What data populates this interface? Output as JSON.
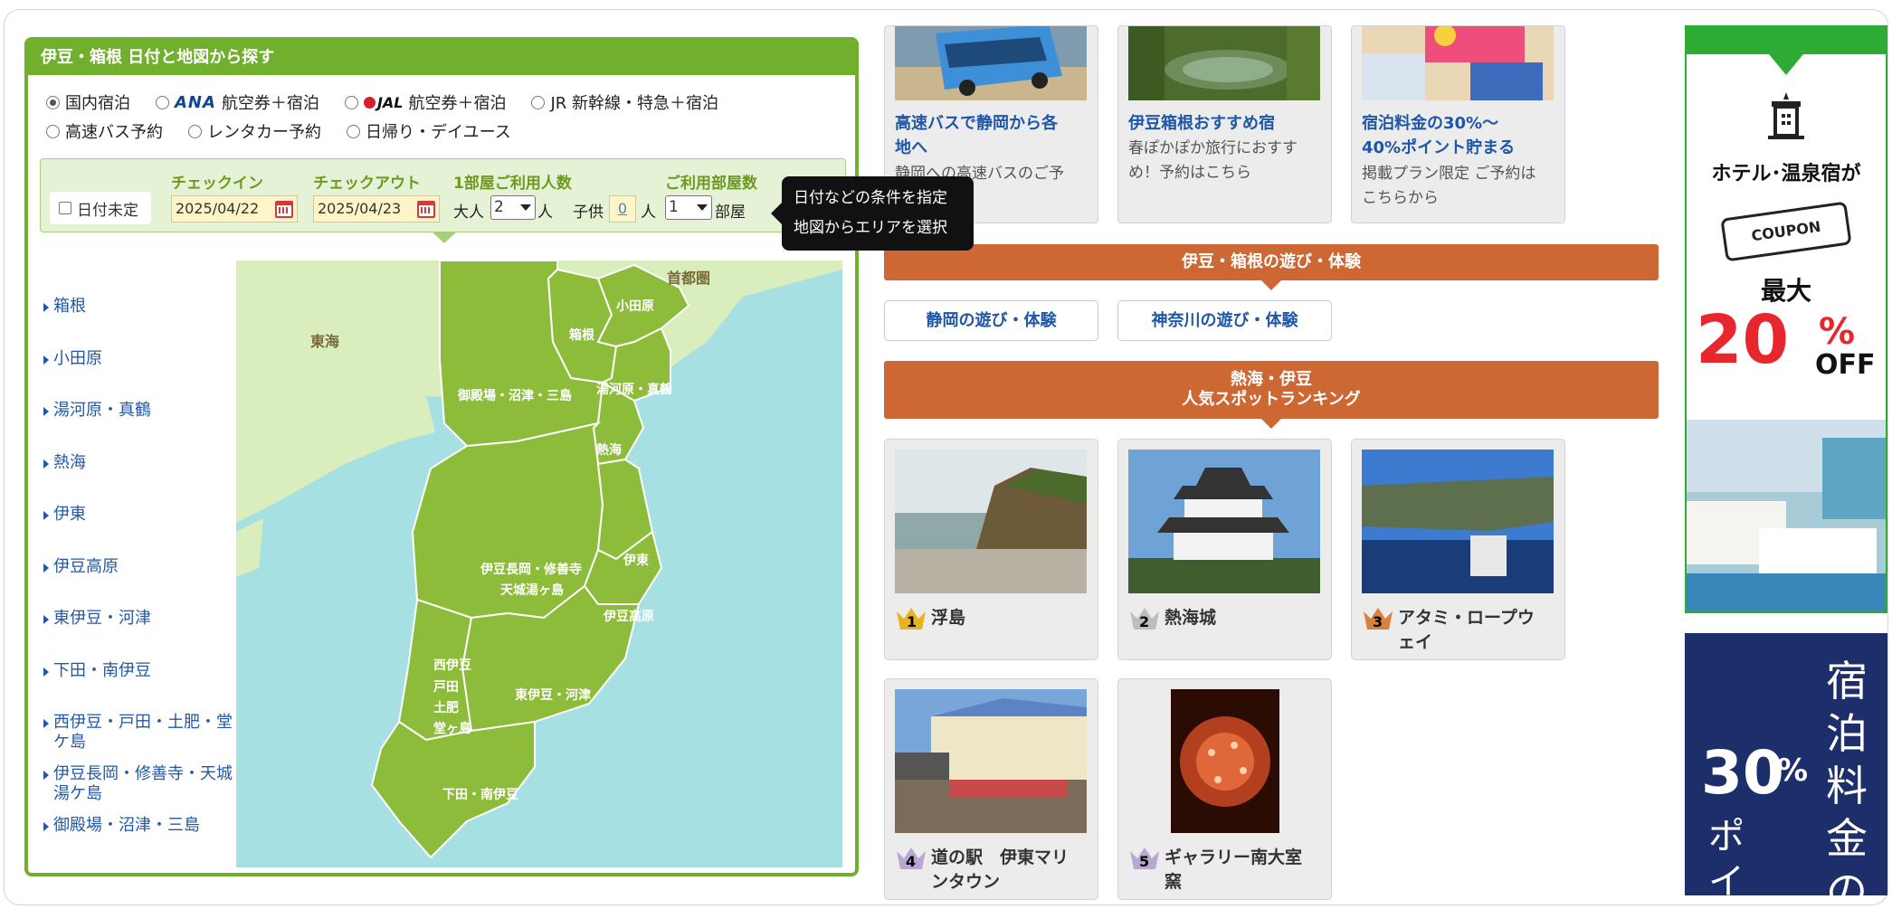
{
  "panel": {
    "title": "伊豆・箱根 日付と地図から探す",
    "radio_options": [
      {
        "label": "国内宿泊",
        "selected": true
      },
      {
        "logo": "ANA",
        "label": "航空券＋宿泊",
        "selected": false
      },
      {
        "logo": "JAL",
        "label": "航空券＋宿泊",
        "selected": false
      },
      {
        "label": "JR 新幹線・特急＋宿泊",
        "selected": false
      },
      {
        "label": "高速バス予約",
        "selected": false
      },
      {
        "label": "レンタカー予約",
        "selected": false
      },
      {
        "label": "日帰り・デイユース",
        "selected": false
      }
    ],
    "conditions": {
      "checkin_label": "チェックイン",
      "checkout_label": "チェックアウト",
      "guests_label": "1部屋ご利用人数",
      "rooms_label": "ご利用部屋数",
      "undated_label": "日付未定",
      "checkin_value": "2025/04/22",
      "checkout_value": "2025/04/23",
      "adults_prefix": "大人",
      "adults_value": "2",
      "person_unit": "人",
      "children_prefix": "子供",
      "children_value": "0",
      "rooms_value": "1",
      "rooms_unit": "部屋"
    },
    "tooltip": {
      "line1": "日付などの条件を指定",
      "line2": "地図からエリアを選択"
    },
    "areas": [
      "箱根",
      "小田原",
      "湯河原・真鶴",
      "熱海",
      "伊東",
      "伊豆高原",
      "東伊豆・河津",
      "下田・南伊豆",
      "西伊豆・戸田・土肥・堂ケ島",
      "伊豆長岡・修善寺・天城湯ケ島",
      "御殿場・沼津・三島"
    ],
    "map_labels": {
      "shutoken": "首都圏",
      "tokai": "東海",
      "odawara": "小田原",
      "hakone": "箱根",
      "gotemba": "御殿場・沼津・三島",
      "yugawara": "湯河原・真鶴",
      "atami": "熱海",
      "ito": "伊東",
      "izunagaoka_1": "伊豆長岡・修善寺",
      "izunagaoka_2": "天城湯ヶ島",
      "izukogen": "伊豆高原",
      "nishiizu_1": "西伊豆",
      "nishiizu_2": "戸田",
      "nishiizu_3": "土肥",
      "nishiizu_4": "堂ヶ島",
      "higashiizu": "東伊豆・河津",
      "shimoda": "下田・南伊豆"
    }
  },
  "promo_cards": [
    {
      "title_1": "高速バスで静岡から各",
      "title_2": "地へ",
      "desc": "静岡への高速バスのご予"
    },
    {
      "title": "伊豆箱根おすすめ宿",
      "desc_1": "春ぽかぽか旅行におすす",
      "desc_2": "め！予約はこちら"
    },
    {
      "title_1": "宿泊料金の30%～",
      "title_2": "40%ポイント貯まる",
      "desc_1": "掲載プラン限定 ご予約は",
      "desc_2": "こちらから"
    }
  ],
  "activities": {
    "header": "伊豆・箱根の遊び・体験",
    "buttons": [
      "静岡の遊び・体験",
      "神奈川の遊び・体験"
    ]
  },
  "ranking": {
    "header_1": "熱海・伊豆",
    "header_2": "人気スポットランキング",
    "items": [
      {
        "rank": "1",
        "name": "浮島"
      },
      {
        "rank": "2",
        "name": "熱海城"
      },
      {
        "rank": "3",
        "name_1": "アタミ・ロープウ",
        "name_2": "ェイ"
      },
      {
        "rank": "4",
        "name_1": "道の駅　伊東マリ",
        "name_2": "ンタウン"
      },
      {
        "rank": "5",
        "name_1": "ギャラリー南大室",
        "name_2": "窯"
      }
    ]
  },
  "ads": {
    "ad1": {
      "line1": "ホテル･温泉宿が",
      "coupon": "COUPON",
      "line2": "最大",
      "pct": "20",
      "pct_sign": "%",
      "off": "OFF"
    },
    "ad2": {
      "pct": "30",
      "pct_sign": "%",
      "v1": "宿泊料金の",
      "v2": "ポイ"
    }
  },
  "colors": {
    "green": "#71b02c",
    "orange": "#cd6734",
    "link": "#2258a6",
    "sea": "#a7e0e3",
    "land": "#8dbb3a"
  }
}
